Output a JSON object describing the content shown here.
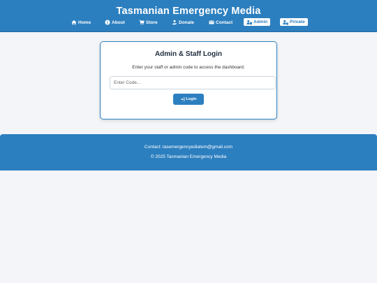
{
  "header": {
    "title": "Tasmanian Emergency Media",
    "nav": [
      {
        "label": "Home",
        "icon": "home-icon"
      },
      {
        "label": "About",
        "icon": "info-icon"
      },
      {
        "label": "Store",
        "icon": "cart-icon"
      },
      {
        "label": "Donate",
        "icon": "donate-icon"
      },
      {
        "label": "Contact",
        "icon": "envelope-icon"
      },
      {
        "label": "Admin",
        "icon": "user-shield-icon"
      },
      {
        "label": "Private",
        "icon": "user-lock-icon"
      }
    ]
  },
  "login": {
    "title": "Admin & Staff Login",
    "description": "Enter your staff or admin code to access the dashboard.",
    "input_placeholder": "Enter Code...",
    "input_value": "",
    "button_label": "Login",
    "button_icon": "sign-in-icon"
  },
  "footer": {
    "contact": "Contact: tasemergencyediatem@gmail.com",
    "copyright": "© 2025 Tasmanian Emergency Media"
  },
  "colors": {
    "primary": "#2c7fbf",
    "background": "#f3f5f8",
    "card": "#ffffff"
  }
}
